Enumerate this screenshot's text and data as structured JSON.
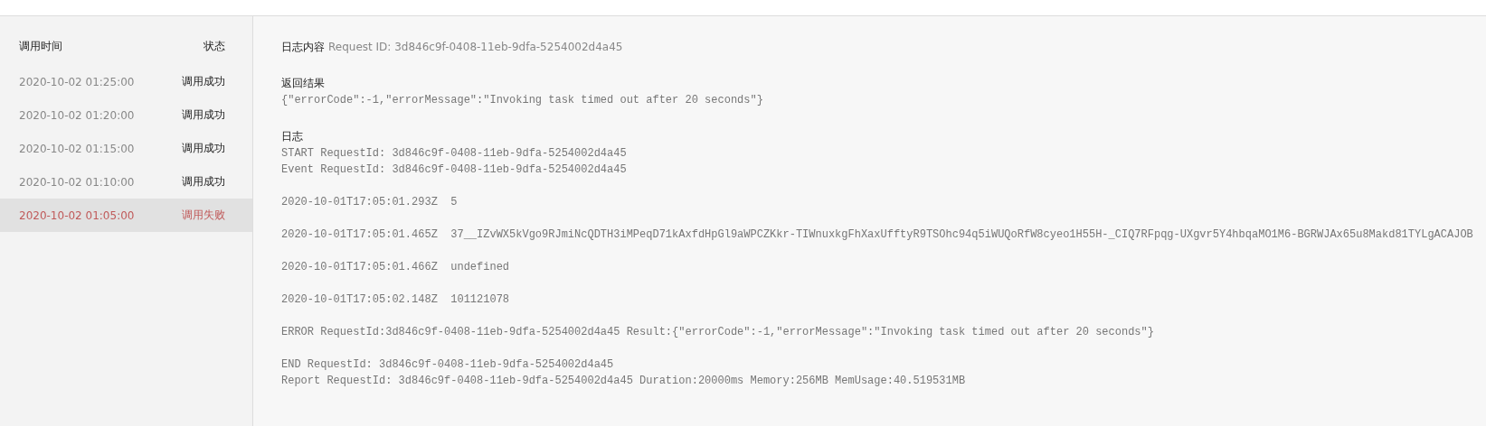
{
  "sidebar": {
    "columns": [
      "调用时间",
      "状态"
    ],
    "rows": [
      {
        "time": "2020-10-02 01:25:00",
        "status": "调用成功",
        "failed": false,
        "selected": false
      },
      {
        "time": "2020-10-02 01:20:00",
        "status": "调用成功",
        "failed": false,
        "selected": false
      },
      {
        "time": "2020-10-02 01:15:00",
        "status": "调用成功",
        "failed": false,
        "selected": false
      },
      {
        "time": "2020-10-02 01:10:00",
        "status": "调用成功",
        "failed": false,
        "selected": false
      },
      {
        "time": "2020-10-02 01:05:00",
        "status": "调用失败",
        "failed": true,
        "selected": true
      }
    ]
  },
  "detail": {
    "title": "日志内容",
    "request_id": "Request ID: 3d846c9f-0408-11eb-9dfa-5254002d4a45",
    "result_heading": "返回结果",
    "result": "{\"errorCode\":-1,\"errorMessage\":\"Invoking task timed out after 20 seconds\"}",
    "log_heading": "日志",
    "log_blocks": [
      [
        "START RequestId: 3d846c9f-0408-11eb-9dfa-5254002d4a45",
        "Event RequestId: 3d846c9f-0408-11eb-9dfa-5254002d4a45"
      ],
      [
        "2020-10-01T17:05:01.293Z  5"
      ],
      [
        "2020-10-01T17:05:01.465Z  37__IZvWX5kVgo9RJmiNcQDTH3iMPeqD71kAxfdHpGl9aWPCZKkr-TIWnuxkgFhXaxUfftyR9TSOhc94q5iWUQoRfW8cyeo1H55H-_CIQ7RFpqg-UXgvr5Y4hbqaMO1M6-BGRWJAx65u8Makd81TYLgACAJOB"
      ],
      [
        "2020-10-01T17:05:01.466Z  undefined"
      ],
      [
        "2020-10-01T17:05:02.148Z  101121078"
      ],
      [
        "ERROR RequestId:3d846c9f-0408-11eb-9dfa-5254002d4a45 Result:{\"errorCode\":-1,\"errorMessage\":\"Invoking task timed out after 20 seconds\"}"
      ],
      [
        "END RequestId: 3d846c9f-0408-11eb-9dfa-5254002d4a45",
        "Report RequestId: 3d846c9f-0408-11eb-9dfa-5254002d4a45 Duration:20000ms Memory:256MB MemUsage:40.519531MB"
      ]
    ]
  }
}
